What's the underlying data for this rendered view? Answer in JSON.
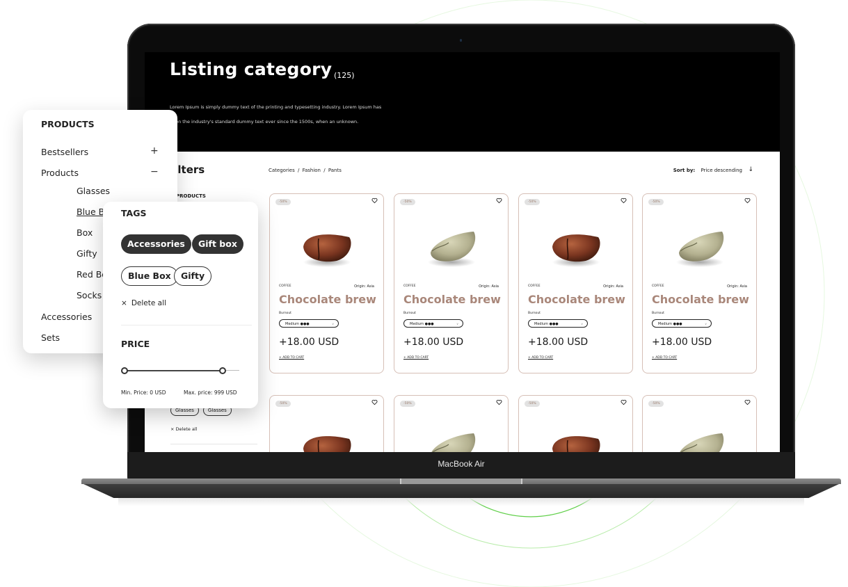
{
  "device": {
    "label": "MacBook Air"
  },
  "hero": {
    "title": "Listing category",
    "count": "(125)",
    "description_line1": "Lorem Ipsum is simply dummy text of the printing and typesetting industry. Lorem Ipsum has",
    "description_line2": "been the industry's standard dummy text ever since the 1500s, when an unknown."
  },
  "filters": {
    "title": "Filters",
    "products_label": "PRODUCTS",
    "back_tags": [
      "Glasses",
      "Glasses"
    ],
    "delete_all": "× Delete all"
  },
  "breadcrumb": {
    "items": [
      "Categories",
      "Fashion",
      "Pants"
    ],
    "separator": "/"
  },
  "sort": {
    "label": "Sort by:",
    "value": "Price descending",
    "arrow_icon": "↓"
  },
  "products": [
    {
      "badge": "-50%",
      "category": "COFFEE",
      "origin": "Origin: Asia",
      "name": "Chocolate brew",
      "burnout_label": "Burnout",
      "burnout_value": "Medium ●●●",
      "price": "+18.00 USD",
      "add_to_cart": "+ ADD TO CART",
      "bean": "roasted"
    },
    {
      "badge": "-50%",
      "category": "COFFEE",
      "origin": "Origin: Asia",
      "name": "Chocolate brew",
      "burnout_label": "Burnout",
      "burnout_value": "Medium ●●●",
      "price": "+18.00 USD",
      "add_to_cart": "+ ADD TO CART",
      "bean": "green"
    },
    {
      "badge": "-50%",
      "category": "COFFEE",
      "origin": "Origin: Asia",
      "name": "Chocolate brew",
      "burnout_label": "Burnout",
      "burnout_value": "Medium ●●●",
      "price": "+18.00 USD",
      "add_to_cart": "+ ADD TO CART",
      "bean": "roasted"
    },
    {
      "badge": "-50%",
      "category": "COFFEE",
      "origin": "Origin: Asia",
      "name": "Chocolate brew",
      "burnout_label": "Burnout",
      "burnout_value": "Medium ●●●",
      "price": "+18.00 USD",
      "add_to_cart": "+ ADD TO CART",
      "bean": "green"
    },
    {
      "badge": "-50%",
      "bean": "roasted"
    },
    {
      "badge": "-50%",
      "bean": "green"
    },
    {
      "badge": "-50%",
      "bean": "roasted"
    },
    {
      "badge": "-50%",
      "bean": "green"
    }
  ],
  "products_panel": {
    "title": "PRODUCTS",
    "items": [
      {
        "label": "Bestsellers",
        "toggle": "+"
      },
      {
        "label": "Products",
        "toggle": "−"
      },
      {
        "label": "Accessories"
      },
      {
        "label": "Sets"
      }
    ],
    "sub_items": [
      "Glasses",
      "Blue Box",
      "Box",
      "Gifty",
      "Red Box",
      "Socks"
    ],
    "active_sub_item": "Blue Box"
  },
  "tags_panel": {
    "title": "TAGS",
    "selected_tags": [
      "Accessories",
      "Gift box"
    ],
    "available_tags": [
      "Blue Box",
      "Gifty"
    ],
    "delete_all": "Delete all",
    "price_title": "PRICE",
    "min_price_label": "Min. Price: 0 USD",
    "max_price_label": "Max. price: 999 USD",
    "range_min_fraction": 0.0,
    "range_max_fraction": 0.85
  },
  "colors": {
    "accent_name": "#a9877a",
    "card_border": "#d6bfb6",
    "circle_green": "#6fd45a"
  }
}
